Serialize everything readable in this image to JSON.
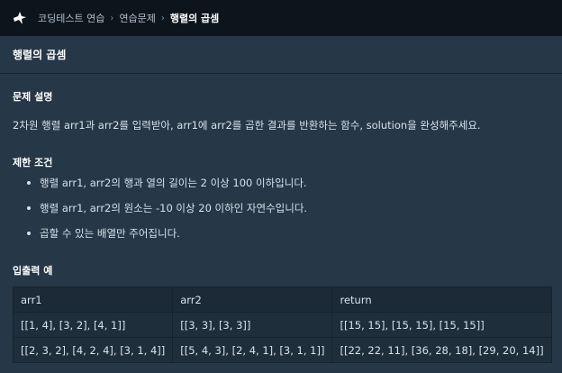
{
  "header": {
    "logo_icon": "programmers-logo-icon",
    "breadcrumb": [
      "코딩테스트 연습",
      "연습문제",
      "행렬의 곱셈"
    ]
  },
  "title": "행렬의 곱셈",
  "sections": {
    "description_heading": "문제 설명",
    "description_text": "2차원 행렬 arr1과 arr2를 입력받아, arr1에 arr2를 곱한 결과를 반환하는 함수, solution을 완성해주세요.",
    "constraints_heading": "제한 조건",
    "constraints": [
      "행렬 arr1, arr2의 행과 열의 길이는 2 이상 100 이하입니다.",
      "행렬 arr1, arr2의 원소는 -10 이상 20 이하인 자연수입니다.",
      "곱할 수 있는 배열만 주어집니다."
    ],
    "examples_heading": "입출력 예"
  },
  "examples_table": {
    "headers": [
      "arr1",
      "arr2",
      "return"
    ],
    "rows": [
      [
        "[[1, 4], [3, 2], [4, 1]]",
        "[[3, 3], [3, 3]]",
        "[[15, 15], [15, 15], [15, 15]]"
      ],
      [
        "[[2, 3, 2], [4, 2, 4], [3, 1, 4]]",
        "[[5, 4, 3], [2, 4, 1], [3, 1, 1]]",
        "[[22, 22, 11], [36, 28, 18], [29, 20, 14]]"
      ]
    ]
  },
  "colors": {
    "topbar_bg": "#0c151c",
    "page_bg": "#263747",
    "table_bg": "#1f2e3b"
  }
}
